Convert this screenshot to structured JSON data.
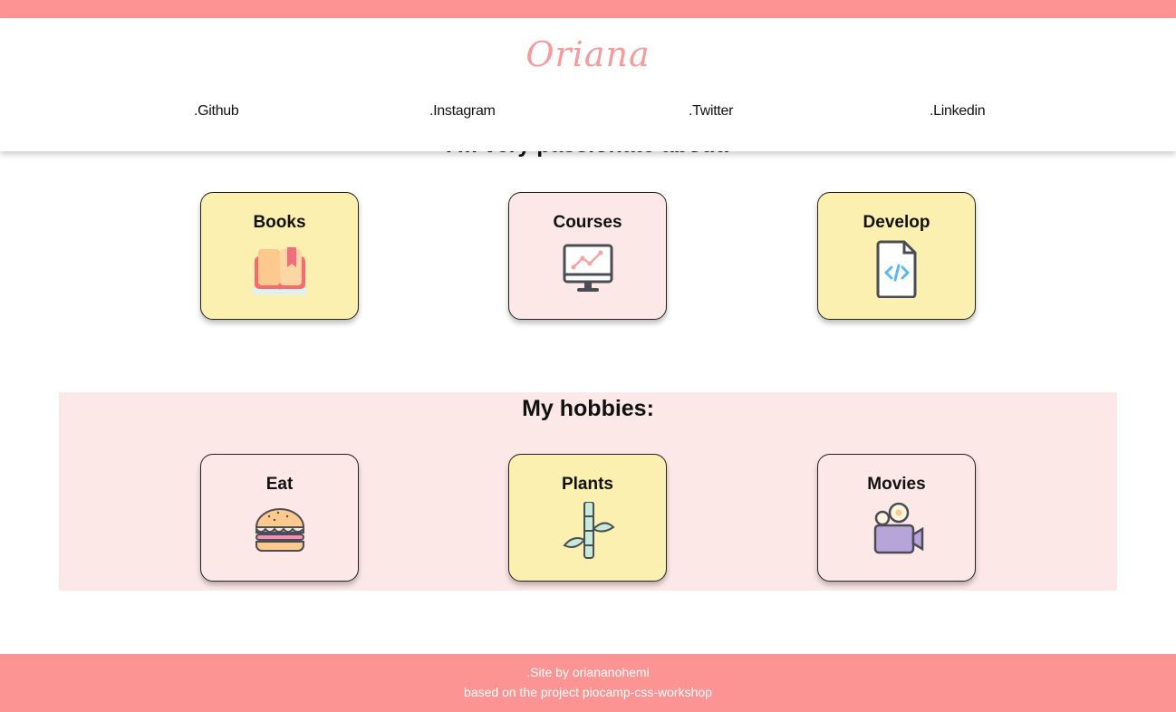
{
  "header": {
    "logo": "Oriana",
    "nav": [
      ".Github",
      ".Instagram",
      ".Twitter",
      ".Linkedin"
    ]
  },
  "passions": {
    "title": "I'm very passionate about:",
    "cards": [
      {
        "label": "Books",
        "icon": "book-icon"
      },
      {
        "label": "Courses",
        "icon": "monitor-chart-icon"
      },
      {
        "label": "Develop",
        "icon": "code-file-icon"
      }
    ]
  },
  "hobbies": {
    "title": "My hobbies:",
    "cards": [
      {
        "label": "Eat",
        "icon": "burger-icon"
      },
      {
        "label": "Plants",
        "icon": "bamboo-icon"
      },
      {
        "label": "Movies",
        "icon": "video-camera-icon"
      }
    ]
  },
  "footer": {
    "line1": ".Site by oriananohemi",
    "line2": "based on the project piocamp-css-workshop"
  },
  "colors": {
    "accent": "#fc9494",
    "card_yellow": "#fcf0b0",
    "card_pink": "#fde8e8"
  }
}
